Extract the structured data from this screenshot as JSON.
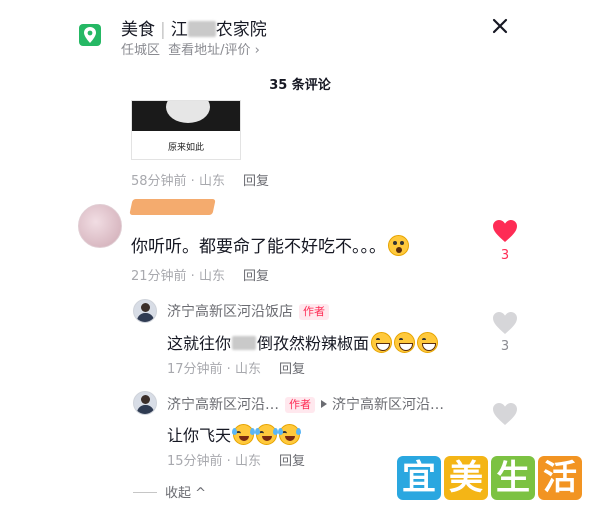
{
  "header": {
    "category": "美食",
    "place_name_prefix": "江",
    "place_name_suffix": "农家院",
    "district": "任城区",
    "address_link": "查看地址/评价 ›",
    "close": "✕"
  },
  "comment_count": "35 条评论",
  "thumbnail": {
    "caption": "原来如此",
    "time": "58分钟前 · 山东",
    "reply": "回复"
  },
  "comments": [
    {
      "text": "你听听。都要命了能不好吃不。。。",
      "time": "21分钟前 · 山东",
      "reply": "回复",
      "likes": "3",
      "liked": true
    }
  ],
  "replies": [
    {
      "author": "济宁高新区河沿饭店",
      "badge": "作者",
      "text_start": "这就往你",
      "text_end": "倒孜然粉辣椒面",
      "time": "17分钟前 · 山东",
      "reply": "回复",
      "likes": "3"
    },
    {
      "author": "济宁高新区河沿…",
      "badge": "作者",
      "reply_to": "济宁高新区河沿…",
      "text": "让你飞天",
      "time": "15分钟前 · 山东",
      "reply": "回复"
    }
  ],
  "collapse_label": "收起 ^",
  "watermark": [
    "宜",
    "美",
    "生",
    "活"
  ],
  "colors": {
    "accent_red": "#fe2c55",
    "location_green": "#25b864",
    "text_primary": "#161823",
    "text_secondary": "#a8a9ae"
  }
}
